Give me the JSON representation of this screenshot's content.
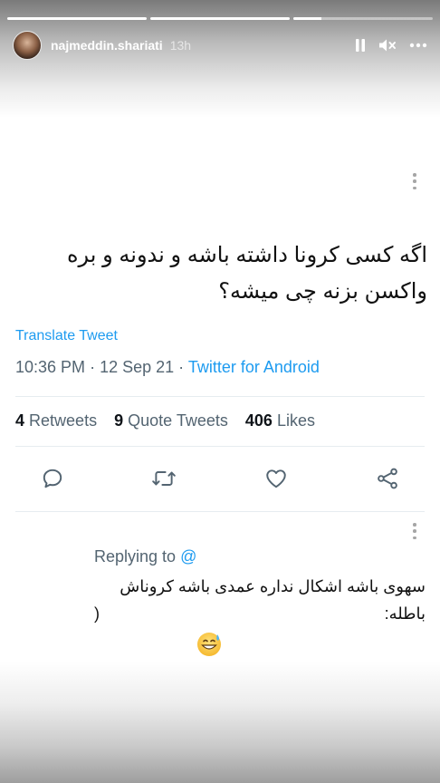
{
  "story": {
    "username": "najmeddin.shariati",
    "timestamp": "13h",
    "progress_segments": [
      1,
      1,
      0.2
    ],
    "icons": [
      "pause-icon",
      "mute-icon",
      "more-icon"
    ]
  },
  "tweet": {
    "text_line1": "اگه کسی کرونا داشته باشه و ندونه و بره",
    "text_line2": "واکسن بزنه چی میشه؟",
    "translate_label": "Translate Tweet",
    "time": "10:36 PM",
    "date": "12 Sep 21",
    "source": "Twitter for Android",
    "retweets_count": "4",
    "retweets_label": "Retweets",
    "quote_count": "9",
    "quote_label": "Quote Tweets",
    "likes_count": "406",
    "likes_label": "Likes",
    "actions": [
      "reply-icon",
      "retweet-icon",
      "like-icon",
      "share-icon"
    ]
  },
  "reply": {
    "replying_to_label": "Replying to",
    "replying_to_handle": "@",
    "text": "سهوی باشه اشکال نداره عمدی باشه کروناش باطله:",
    "paren": ")",
    "emoji": "grinning-sweat-emoji"
  },
  "colors": {
    "link": "#1d9bf0",
    "muted": "#536471",
    "text": "#0f1419",
    "icon": "#536471"
  }
}
